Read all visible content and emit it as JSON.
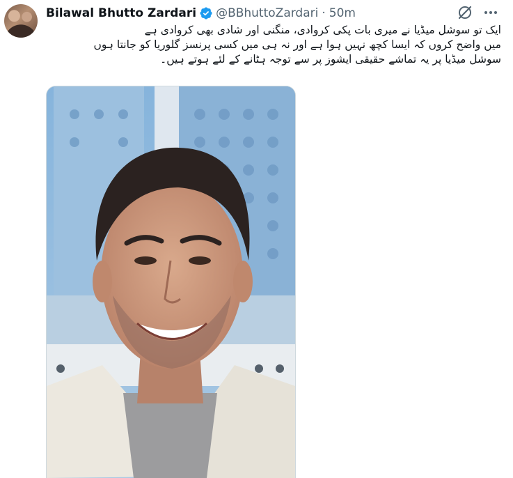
{
  "author": {
    "display_name": "Bilawal Bhutto Zardari",
    "handle": "@BBhuttoZardari",
    "separator": "·",
    "timestamp": "50m",
    "verified_icon": "verified-badge-icon"
  },
  "actions": {
    "grok_icon": "grok-icon",
    "more_icon": "more-icon"
  },
  "tweet": {
    "lines": [
      "ایک تو سوشل میڈیا نے میری بات پکی کروادی، منگنی اور شادی بھی کروادی ہے",
      "میں واضح کروں کہ ایسا کچھ نہیں ہوا ہے اور نہ ہی میں کسی پرنسز گلوریا کو جانتا ہوں",
      "سوشل میڈیا پر یہ تماشے حقیقی ایشوز پر سے توجہ ہٹانے کے لئے ہوتے ہیں۔"
    ]
  },
  "colors": {
    "text": "#0f1419",
    "secondary": "#536471",
    "verified": "#1d9bf0"
  }
}
